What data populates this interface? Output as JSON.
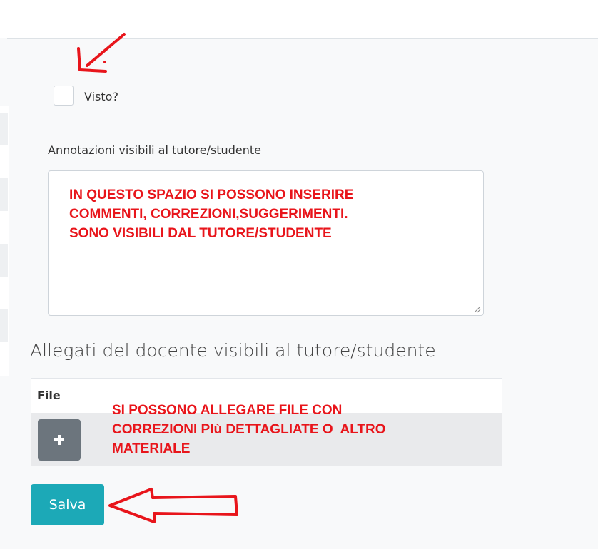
{
  "form": {
    "checkbox_label": "Visto?",
    "checked": false,
    "notes_label": "Annotazioni visibili al tutore/studente",
    "notes_value": ""
  },
  "attachments": {
    "section_title": "Allegati del docente visibili al tutore/studente",
    "column_header": "File",
    "add_icon": "plus-icon"
  },
  "actions": {
    "save_label": "Salva"
  },
  "annotations": {
    "note_textarea": "IN QUESTO SPAZIO SI POSSONO INSERIRE\nCOMMENTI, CORREZIONI,SUGGERIMENTI.\nSONO VISIBILI DAL TUTORE/STUDENTE",
    "note_attachments": "SI POSSONO ALLEGARE FILE CON\nCORREZIONI PIù DETTAGLIATE O  ALTRO\nMATERIALE",
    "arrow_checkbox": "arrow-pointing-down-left",
    "arrow_save": "arrow-pointing-left",
    "color": "#e8151b"
  },
  "theme": {
    "primary": "#1ca9b7",
    "secondary_button": "#6c757d",
    "border": "#ced4da"
  }
}
